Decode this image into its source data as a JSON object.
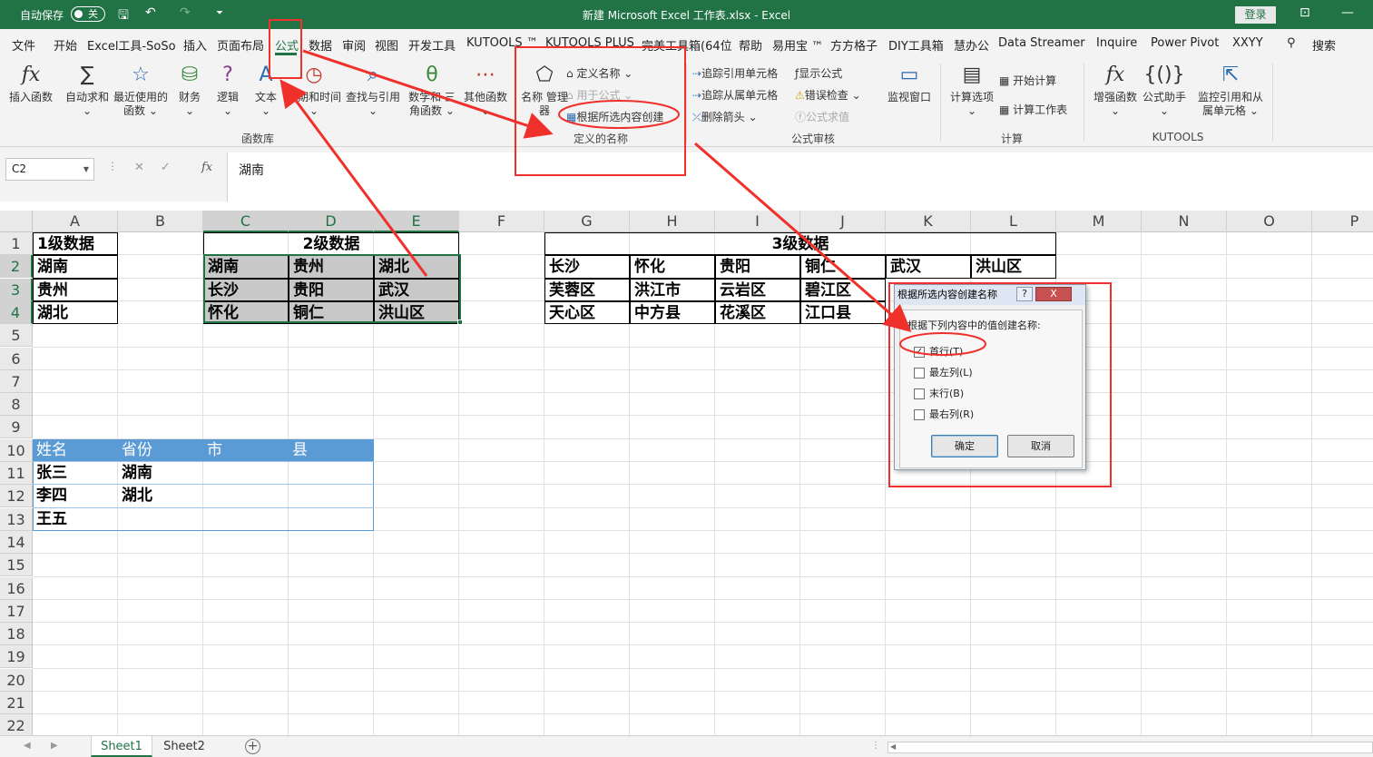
{
  "titlebar": {
    "autosave_label": "自动保存",
    "autosave_state": "关",
    "title": "新建 Microsoft Excel 工作表.xlsx  -  Excel",
    "login": "登录",
    "color": "#217346"
  },
  "menu": [
    "文件",
    "开始",
    "Excel工具-SoSo",
    "插入",
    "页面布局",
    "公式",
    "数据",
    "审阅",
    "视图",
    "开发工具",
    "KUTOOLS ™",
    "KUTOOLS PLUS",
    "完美工具箱(64位",
    "帮助",
    "易用宝 ™",
    "方方格子",
    "DIY工具箱",
    "慧办公",
    "Data Streamer",
    "Inquire",
    "Power Pivot",
    "XXYY",
    "搜索"
  ],
  "menu_active": "公式",
  "ribbon": {
    "function_library": {
      "group_label": "函数库",
      "buttons": [
        "插入函数",
        "自动求和",
        "最近使用的 函数",
        "财务",
        "逻辑",
        "文本",
        "日期和时间",
        "查找与引用",
        "数学和 三角函数",
        "其他函数"
      ]
    },
    "defined_names": {
      "group_label": "定义的名称",
      "name_manager": "名称 管理器",
      "define_name": "定义名称",
      "use_in_formula": "用于公式",
      "create_from_selection": "根据所选内容创建"
    },
    "formula_auditing": {
      "group_label": "公式审核",
      "trace_precedents": "追踪引用单元格",
      "trace_dependents": "追踪从属单元格",
      "remove_arrows": "删除箭头",
      "show_formulas": "显示公式",
      "error_checking": "错误检查",
      "evaluate_formula": "公式求值",
      "watch_window": "监视窗口"
    },
    "calculation": {
      "group_label": "计算",
      "options": "计算选项",
      "calc_now": "开始计算",
      "calc_sheet": "计算工作表"
    },
    "kutools": {
      "group_label": "KUTOOLS",
      "enhanced_functions": "增强函数",
      "formula_helper": "公式助手",
      "monitor": "监控引用和从 属单元格"
    }
  },
  "formula_bar": {
    "name_box": "C2",
    "fx": "fx",
    "value": "湖南"
  },
  "columns": [
    "A",
    "B",
    "C",
    "D",
    "E",
    "F",
    "G",
    "H",
    "I",
    "J",
    "K",
    "L",
    "M",
    "N",
    "O",
    "P"
  ],
  "rows": [
    "1",
    "2",
    "3",
    "4",
    "5",
    "6",
    "7",
    "8",
    "9",
    "10",
    "11",
    "12",
    "13",
    "14",
    "15",
    "16",
    "17",
    "18",
    "19",
    "20",
    "21",
    "22"
  ],
  "sheet": {
    "level1": {
      "title": "1级数据",
      "items": [
        "湖南",
        "贵州",
        "湖北"
      ]
    },
    "level2": {
      "title": "2级数据",
      "headers": [
        "湖南",
        "贵州",
        "湖北"
      ],
      "rows": [
        [
          "长沙",
          "贵阳",
          "武汉"
        ],
        [
          "怀化",
          "铜仁",
          "洪山区"
        ]
      ]
    },
    "level3": {
      "title": "3级数据",
      "headers": [
        "长沙",
        "怀化",
        "贵阳",
        "铜仁",
        "武汉",
        "洪山区"
      ],
      "rows": [
        [
          "芙蓉区",
          "洪江市",
          "云岩区",
          "碧江区"
        ],
        [
          "天心区",
          "中方县",
          "花溪区",
          "江口县"
        ]
      ]
    },
    "table": {
      "headers": [
        "姓名",
        "省份",
        "市",
        "县"
      ],
      "rows": [
        [
          "张三",
          "湖南"
        ],
        [
          "李四",
          "湖北"
        ],
        [
          "王五",
          ""
        ]
      ],
      "header_color": "#5b9bd5"
    }
  },
  "dialog": {
    "title": "根据所选内容创建名称",
    "help": "?",
    "close": "X",
    "prompt": "根据下列内容中的值创建名称:",
    "options": [
      {
        "label": "首行(T)",
        "checked": true
      },
      {
        "label": "最左列(L)",
        "checked": false
      },
      {
        "label": "末行(B)",
        "checked": false
      },
      {
        "label": "最右列(R)",
        "checked": false
      }
    ],
    "ok": "确定",
    "cancel": "取消"
  },
  "sheets": {
    "tabs": [
      "Sheet1",
      "Sheet2"
    ],
    "active": "Sheet1"
  },
  "annotation_color": "#f0302a"
}
